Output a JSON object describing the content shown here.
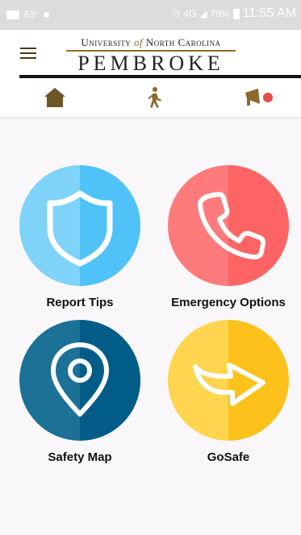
{
  "status_bar": {
    "temperature": "63°",
    "network": "4G",
    "battery": "79%",
    "time": "11:55 AM"
  },
  "header": {
    "logo_line1_a": "University",
    "logo_line1_of": "of",
    "logo_line1_b": "North Carolina",
    "logo_line2": "PEMBROKE"
  },
  "nav": {
    "items": [
      {
        "name": "home",
        "icon": "home-icon"
      },
      {
        "name": "walk",
        "icon": "walking-person-icon"
      },
      {
        "name": "alerts",
        "icon": "megaphone-icon"
      }
    ]
  },
  "tiles": [
    {
      "label": "Report Tips",
      "icon": "shield-icon",
      "color_light": "#7fd3f9",
      "color_dark": "#4fc3f7"
    },
    {
      "label": "Emergency Options",
      "icon": "phone-icon",
      "color_light": "#ff7b7b",
      "color_dark": "#ff6464"
    },
    {
      "label": "Safety Map",
      "icon": "map-pin-icon",
      "color_light": "#1b7196",
      "color_dark": "#015d87"
    },
    {
      "label": "GoSafe",
      "icon": "arrow-right-icon",
      "color_light": "#ffd54f",
      "color_dark": "#fcc21b"
    }
  ],
  "colors": {
    "brand_gold": "#8d6a2c",
    "brand_brown": "#6e5526",
    "alert_red": "#e94b4b"
  }
}
